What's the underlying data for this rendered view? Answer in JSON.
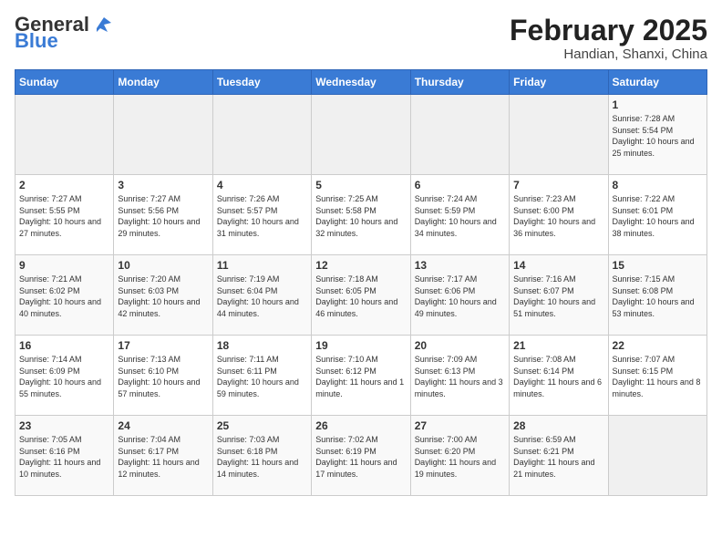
{
  "header": {
    "logo_general": "General",
    "logo_blue": "Blue",
    "title": "February 2025",
    "subtitle": "Handian, Shanxi, China"
  },
  "weekdays": [
    "Sunday",
    "Monday",
    "Tuesday",
    "Wednesday",
    "Thursday",
    "Friday",
    "Saturday"
  ],
  "weeks": [
    [
      {
        "num": "",
        "info": ""
      },
      {
        "num": "",
        "info": ""
      },
      {
        "num": "",
        "info": ""
      },
      {
        "num": "",
        "info": ""
      },
      {
        "num": "",
        "info": ""
      },
      {
        "num": "",
        "info": ""
      },
      {
        "num": "1",
        "info": "Sunrise: 7:28 AM\nSunset: 5:54 PM\nDaylight: 10 hours and 25 minutes."
      }
    ],
    [
      {
        "num": "2",
        "info": "Sunrise: 7:27 AM\nSunset: 5:55 PM\nDaylight: 10 hours and 27 minutes."
      },
      {
        "num": "3",
        "info": "Sunrise: 7:27 AM\nSunset: 5:56 PM\nDaylight: 10 hours and 29 minutes."
      },
      {
        "num": "4",
        "info": "Sunrise: 7:26 AM\nSunset: 5:57 PM\nDaylight: 10 hours and 31 minutes."
      },
      {
        "num": "5",
        "info": "Sunrise: 7:25 AM\nSunset: 5:58 PM\nDaylight: 10 hours and 32 minutes."
      },
      {
        "num": "6",
        "info": "Sunrise: 7:24 AM\nSunset: 5:59 PM\nDaylight: 10 hours and 34 minutes."
      },
      {
        "num": "7",
        "info": "Sunrise: 7:23 AM\nSunset: 6:00 PM\nDaylight: 10 hours and 36 minutes."
      },
      {
        "num": "8",
        "info": "Sunrise: 7:22 AM\nSunset: 6:01 PM\nDaylight: 10 hours and 38 minutes."
      }
    ],
    [
      {
        "num": "9",
        "info": "Sunrise: 7:21 AM\nSunset: 6:02 PM\nDaylight: 10 hours and 40 minutes."
      },
      {
        "num": "10",
        "info": "Sunrise: 7:20 AM\nSunset: 6:03 PM\nDaylight: 10 hours and 42 minutes."
      },
      {
        "num": "11",
        "info": "Sunrise: 7:19 AM\nSunset: 6:04 PM\nDaylight: 10 hours and 44 minutes."
      },
      {
        "num": "12",
        "info": "Sunrise: 7:18 AM\nSunset: 6:05 PM\nDaylight: 10 hours and 46 minutes."
      },
      {
        "num": "13",
        "info": "Sunrise: 7:17 AM\nSunset: 6:06 PM\nDaylight: 10 hours and 49 minutes."
      },
      {
        "num": "14",
        "info": "Sunrise: 7:16 AM\nSunset: 6:07 PM\nDaylight: 10 hours and 51 minutes."
      },
      {
        "num": "15",
        "info": "Sunrise: 7:15 AM\nSunset: 6:08 PM\nDaylight: 10 hours and 53 minutes."
      }
    ],
    [
      {
        "num": "16",
        "info": "Sunrise: 7:14 AM\nSunset: 6:09 PM\nDaylight: 10 hours and 55 minutes."
      },
      {
        "num": "17",
        "info": "Sunrise: 7:13 AM\nSunset: 6:10 PM\nDaylight: 10 hours and 57 minutes."
      },
      {
        "num": "18",
        "info": "Sunrise: 7:11 AM\nSunset: 6:11 PM\nDaylight: 10 hours and 59 minutes."
      },
      {
        "num": "19",
        "info": "Sunrise: 7:10 AM\nSunset: 6:12 PM\nDaylight: 11 hours and 1 minute."
      },
      {
        "num": "20",
        "info": "Sunrise: 7:09 AM\nSunset: 6:13 PM\nDaylight: 11 hours and 3 minutes."
      },
      {
        "num": "21",
        "info": "Sunrise: 7:08 AM\nSunset: 6:14 PM\nDaylight: 11 hours and 6 minutes."
      },
      {
        "num": "22",
        "info": "Sunrise: 7:07 AM\nSunset: 6:15 PM\nDaylight: 11 hours and 8 minutes."
      }
    ],
    [
      {
        "num": "23",
        "info": "Sunrise: 7:05 AM\nSunset: 6:16 PM\nDaylight: 11 hours and 10 minutes."
      },
      {
        "num": "24",
        "info": "Sunrise: 7:04 AM\nSunset: 6:17 PM\nDaylight: 11 hours and 12 minutes."
      },
      {
        "num": "25",
        "info": "Sunrise: 7:03 AM\nSunset: 6:18 PM\nDaylight: 11 hours and 14 minutes."
      },
      {
        "num": "26",
        "info": "Sunrise: 7:02 AM\nSunset: 6:19 PM\nDaylight: 11 hours and 17 minutes."
      },
      {
        "num": "27",
        "info": "Sunrise: 7:00 AM\nSunset: 6:20 PM\nDaylight: 11 hours and 19 minutes."
      },
      {
        "num": "28",
        "info": "Sunrise: 6:59 AM\nSunset: 6:21 PM\nDaylight: 11 hours and 21 minutes."
      },
      {
        "num": "",
        "info": ""
      }
    ]
  ]
}
